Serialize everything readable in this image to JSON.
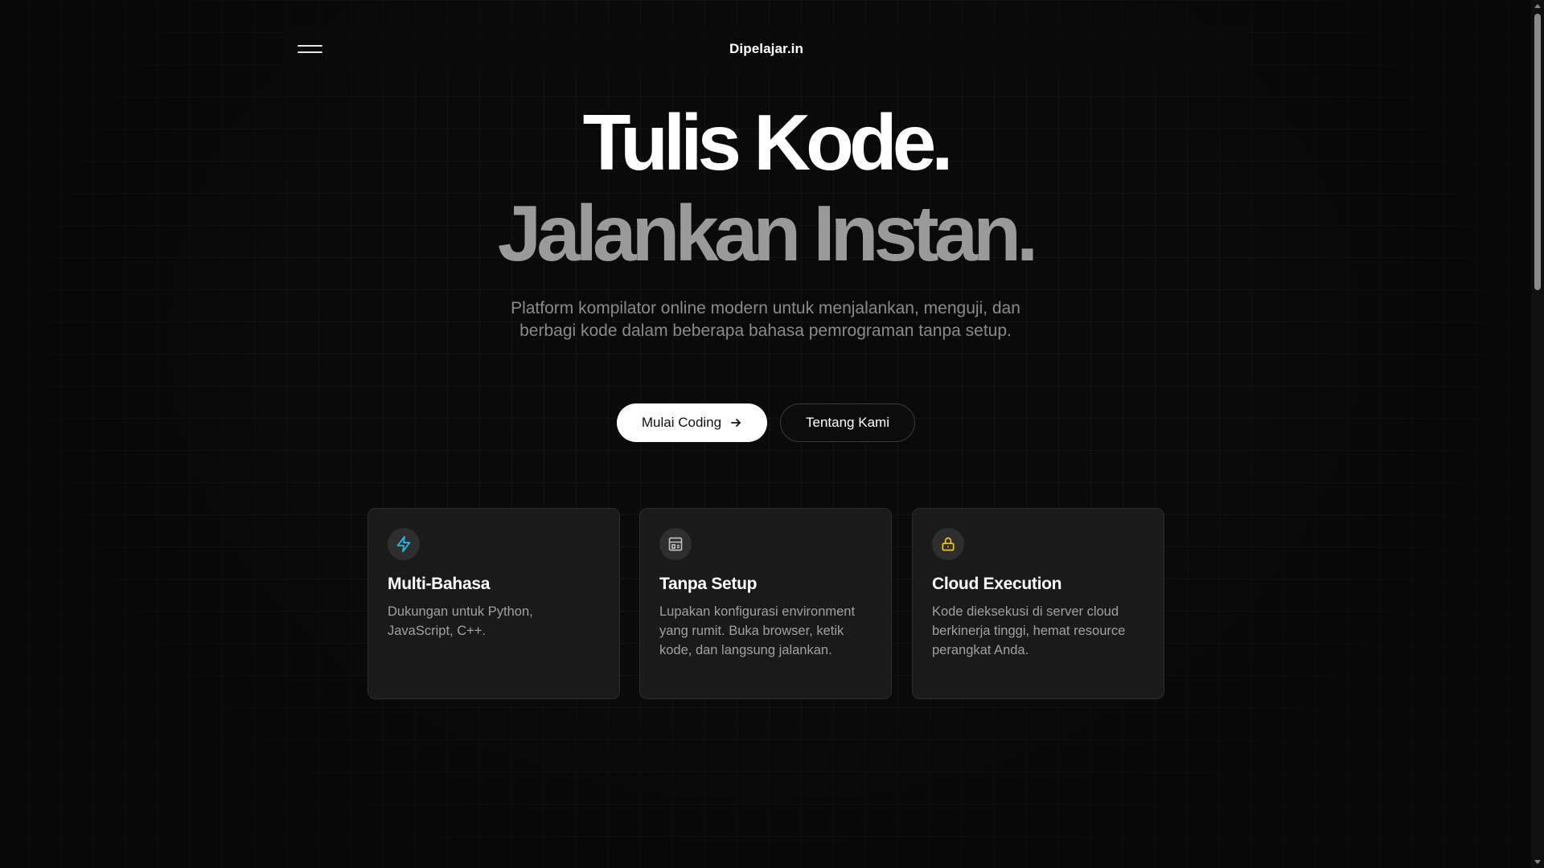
{
  "nav": {
    "brand": "Dipelajar.in",
    "menu_icon": "hamburger-menu-icon"
  },
  "hero": {
    "line1": "Tulis Kode.",
    "line2": "Jalankan Instan.",
    "subtitle": "Platform kompilator online modern untuk menjalankan, menguji, dan berbagi kode dalam beberapa bahasa pemrograman tanpa setup."
  },
  "actions": {
    "primary_label": "Mulai Coding",
    "primary_icon": "arrow-right-icon",
    "secondary_label": "Tentang Kami"
  },
  "features": [
    {
      "icon": "lightning-icon",
      "icon_color": "#22b8e6",
      "title": "Multi-Bahasa",
      "description": "Dukungan untuk Python, JavaScript, C++."
    },
    {
      "icon": "layout-icon",
      "icon_color": "#bdbdbd",
      "title": "Tanpa Setup",
      "description": "Lupakan konfigurasi environment yang rumit. Buka browser, ketik kode, dan langsung jalankan."
    },
    {
      "icon": "lock-icon",
      "icon_color": "#f5c518",
      "title": "Cloud Execution",
      "description": "Kode dieksekusi di server cloud berkinerja tinggi, hemat resource perangkat Anda."
    }
  ],
  "colors": {
    "background": "#0a0a0a",
    "card_background": "#1a1a1a",
    "hero_secondary": "#9a9a9a",
    "subtitle": "#8a8a8a"
  }
}
